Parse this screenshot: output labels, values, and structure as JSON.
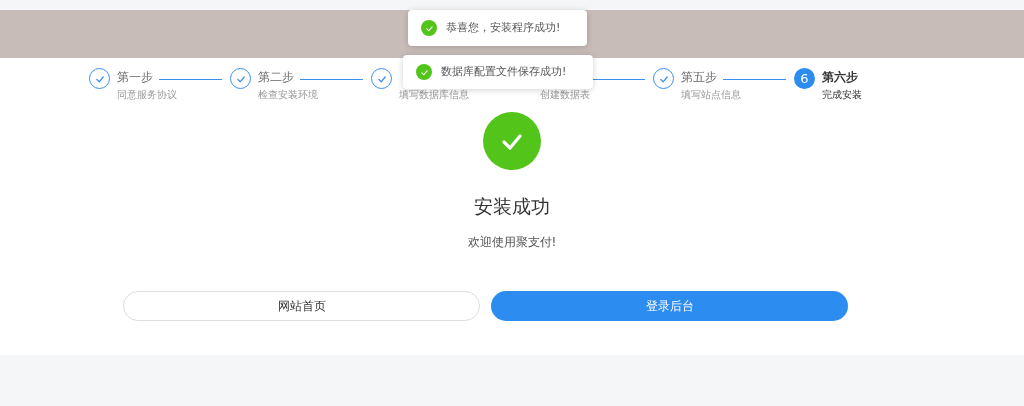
{
  "toasts": [
    {
      "text": "恭喜您，安装程序成功!"
    },
    {
      "text": "数据库配置文件保存成功!"
    }
  ],
  "steps": [
    {
      "title": "第一步",
      "description": "同意服务协议",
      "done": true
    },
    {
      "title": "第二步",
      "description": "检查安装环境",
      "done": true
    },
    {
      "description": "填写数据库信息",
      "done": true
    },
    {
      "description": "创建数据表"
    },
    {
      "title": "第五步",
      "description": "填写站点信息",
      "done": true
    },
    {
      "title": "第六步",
      "description": "完成安装",
      "done": false,
      "number": "6"
    }
  ],
  "result": {
    "title": "安装成功",
    "message": "欢迎使用聚支付!"
  },
  "buttons": [
    {
      "label": "网站首页",
      "kind": "secondary"
    },
    {
      "label": "登录后台",
      "kind": "primary"
    }
  ]
}
